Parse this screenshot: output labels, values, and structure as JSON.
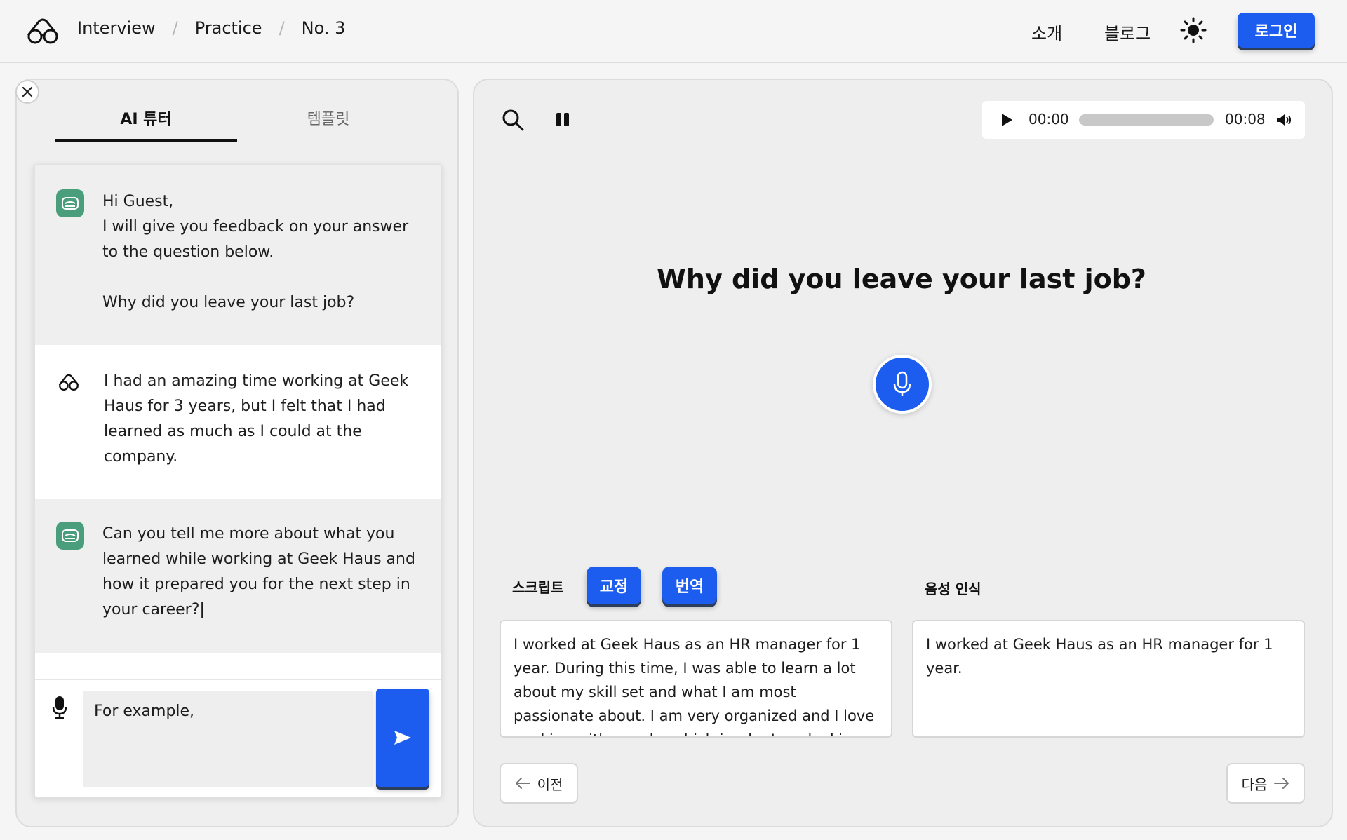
{
  "header": {
    "breadcrumbs": [
      "Interview",
      "Practice",
      "No. 3"
    ],
    "nav": {
      "about": "소개",
      "blog": "블로그"
    },
    "login_label": "로그인"
  },
  "left_panel": {
    "tabs": [
      {
        "label": "AI 튜터",
        "active": true
      },
      {
        "label": "템플릿",
        "active": false
      }
    ],
    "messages": [
      {
        "role": "ai",
        "text": "Hi Guest,\nI will give you feedback on your answer to the question below.\n\nWhy did you leave your last job?"
      },
      {
        "role": "user",
        "text": "I had an amazing time working at Geek Haus for 3 years, but I felt that I had learned as much as I could at the company."
      },
      {
        "role": "ai",
        "text": "Can you tell me more about what you learned while working at Geek Haus and how it prepared you for the next step in your career?|"
      }
    ],
    "input_value": "For example,"
  },
  "player": {
    "current_time": "00:00",
    "duration": "00:08",
    "progress": 0
  },
  "question": "Why did you leave your last job?",
  "script": {
    "label": "스크립트",
    "correct_label": "교정",
    "translate_label": "번역",
    "text": "I worked at Geek Haus as an HR manager for 1 year. During this time, I was able to learn a lot about my skill set and what I am most passionate about. I am very organized and I love working with people, which is why I am looking to fully utilize my"
  },
  "speech_recognition": {
    "label": "음성 인식",
    "text": "I worked at Geek Haus as an HR manager for 1 year."
  },
  "pagination": {
    "prev_label": "이전",
    "next_label": "다음"
  },
  "colors": {
    "accent": "#1c5df0",
    "ai_avatar": "#4a9e7c"
  }
}
